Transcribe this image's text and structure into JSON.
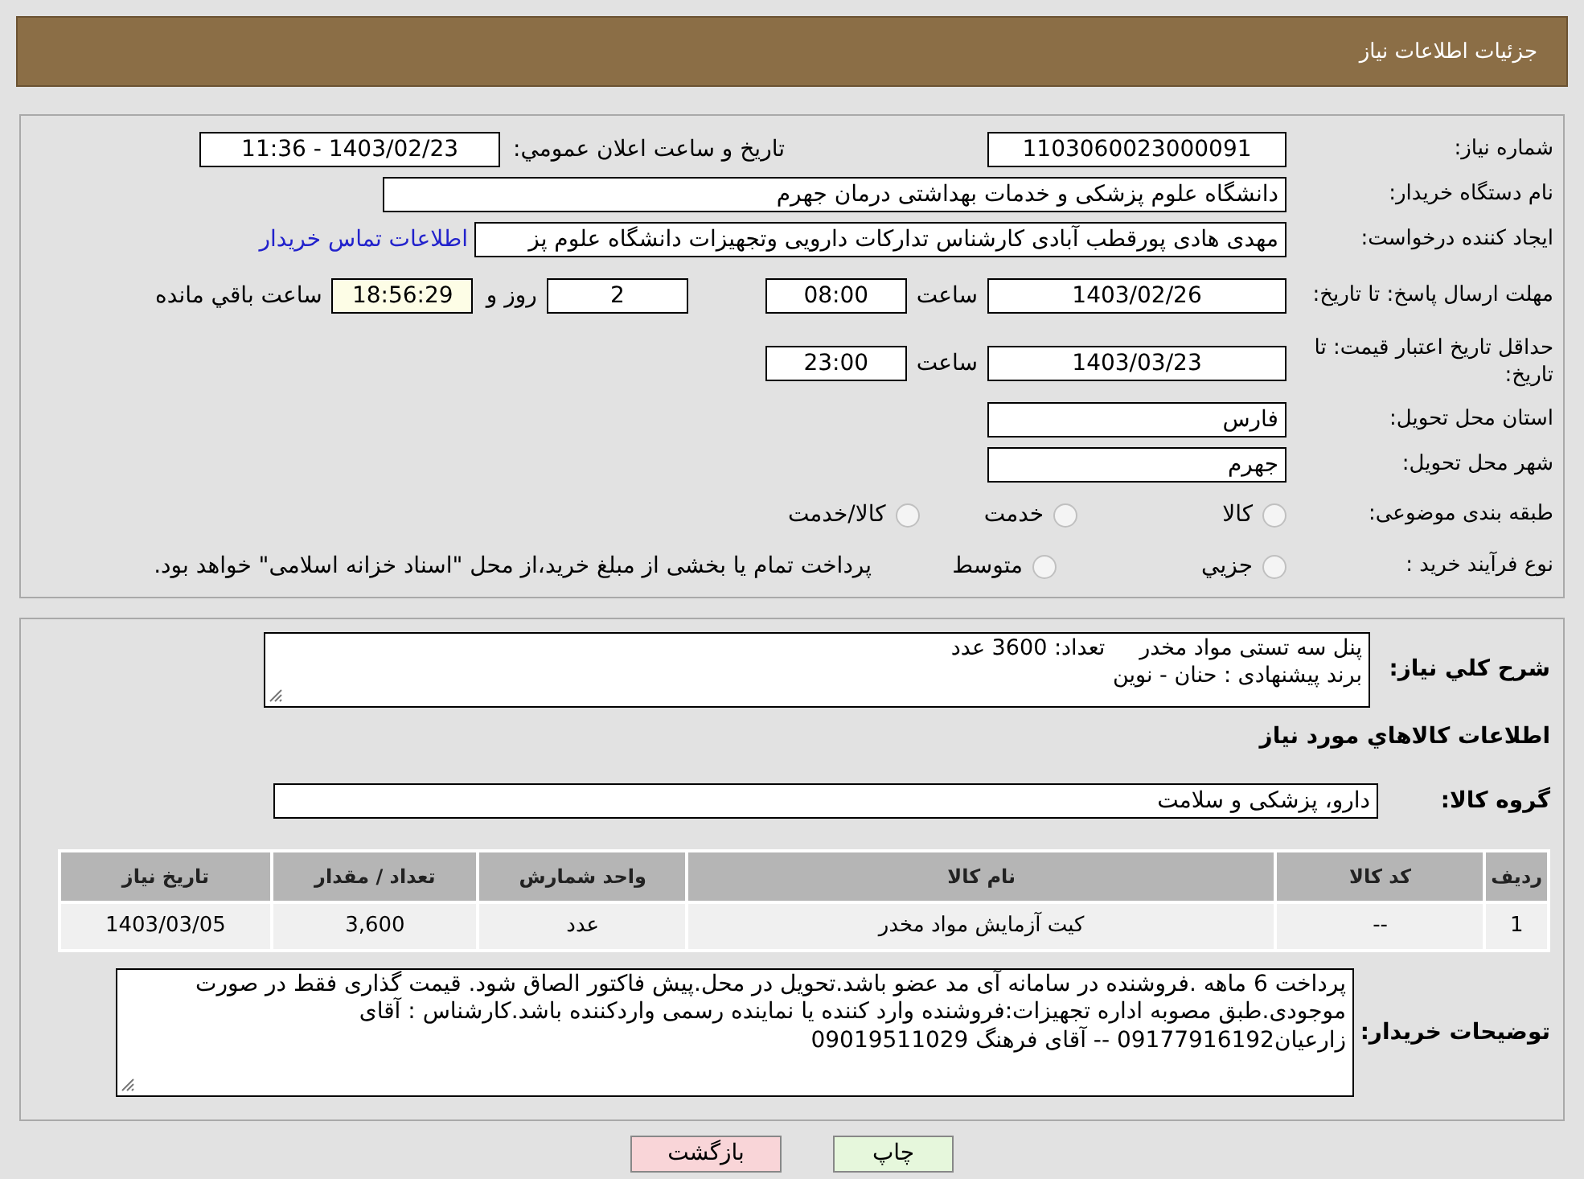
{
  "header": {
    "title": "جزئیات اطلاعات نیاز"
  },
  "need_number": {
    "label": "شماره نیاز:",
    "value": "1103060023000091"
  },
  "announce": {
    "label": "تاریخ و ساعت اعلان عمومي:",
    "value": "1403/02/23 - 11:36"
  },
  "buyer": {
    "label": "نام دستگاه خریدار:",
    "value": "دانشگاه علوم پزشکی و خدمات بهداشتی  درمان جهرم"
  },
  "creator": {
    "label": "ایجاد کننده درخواست:",
    "value": "مهدی هادی پورقطب آبادی کارشناس تدارکات دارویی وتجهیزات دانشگاه علوم پز",
    "link": "اطلاعات تماس خریدار"
  },
  "deadline": {
    "label": "مهلت ارسال پاسخ: تا تاریخ:",
    "date": "1403/02/26",
    "time_label": "ساعت",
    "time": "08:00",
    "days": "2",
    "days_label": "روز و",
    "remaining": "18:56:29",
    "remaining_label": "ساعت باقي مانده"
  },
  "validity": {
    "label": "حداقل تاریخ اعتبار قیمت: تا تاریخ:",
    "date": "1403/03/23",
    "time_label": "ساعت",
    "time": "23:00"
  },
  "province": {
    "label": "استان محل تحویل:",
    "value": "فارس"
  },
  "city": {
    "label": "شهر محل تحویل:",
    "value": "جهرم"
  },
  "category": {
    "label": "طبقه بندی موضوعی:",
    "options": [
      {
        "label": "کالا",
        "selected": false
      },
      {
        "label": "خدمت",
        "selected": false
      },
      {
        "label": "کالا/خدمت",
        "selected": false
      }
    ]
  },
  "process": {
    "label": "نوع فرآیند خرید :",
    "options": [
      {
        "label": "جزيي",
        "selected": false
      },
      {
        "label": "متوسط",
        "selected": false
      }
    ],
    "note": "پرداخت تمام یا بخشی از مبلغ خرید،از محل \"اسناد خزانه اسلامی\" خواهد بود."
  },
  "summary": {
    "label": "شرح کلي نیاز:",
    "lines": [
      "پنل سه تستی مواد مخدر     تعداد: 3600 عدد",
      "برند پیشنهادی : حنان - نوین"
    ]
  },
  "goods_heading": "اطلاعات کالاهاي مورد نیاز",
  "goods_group": {
    "label": "گروه کالا:",
    "value": "دارو، پزشکی و سلامت"
  },
  "table": {
    "columns": [
      "ردیف",
      "کد کالا",
      "نام کالا",
      "واحد شمارش",
      "تعداد / مقدار",
      "تاریخ نیاز"
    ],
    "rows": [
      [
        "1",
        "--",
        "کیت آزمایش مواد مخدر",
        "عدد",
        "3,600",
        "1403/03/05"
      ]
    ]
  },
  "buyer_notes": {
    "label": "توضیحات خریدار:",
    "text": "پرداخت 6 ماهه .فروشنده در سامانه آی مد عضو باشد.تحویل در محل.پیش فاکتور الصاق شود. قیمت گذاری فقط در صورت موجودی.طبق مصوبه اداره تجهیزات:فروشنده وارد کننده یا نماینده رسمی واردکننده باشد.کارشناس : آقای زارعیان09177916192 -- آقای فرهنگ 09019511029"
  },
  "buttons": [
    {
      "label": "چاپ",
      "kind": "print"
    },
    {
      "label": "بازگشت",
      "kind": "back"
    }
  ]
}
